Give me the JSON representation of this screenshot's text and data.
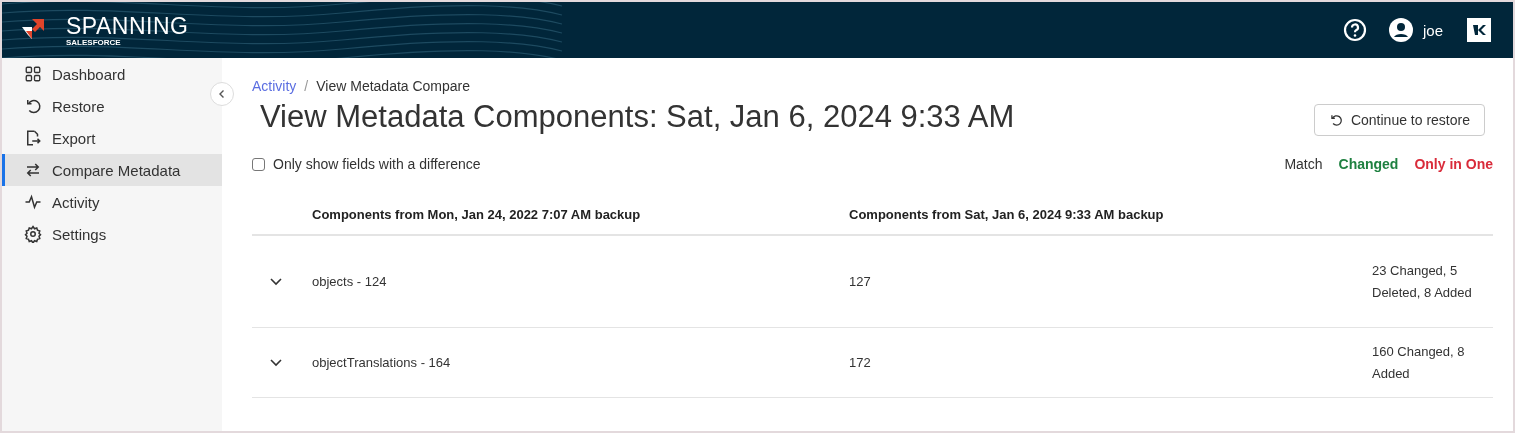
{
  "header": {
    "brand": "SPANNING",
    "sub_brand": "SALESFORCE",
    "user": "joe"
  },
  "sidebar": {
    "items": [
      {
        "label": "Dashboard",
        "kind": "grid",
        "selected": false
      },
      {
        "label": "Restore",
        "kind": "restore",
        "selected": false
      },
      {
        "label": "Export",
        "kind": "export",
        "selected": false
      },
      {
        "label": "Compare Metadata",
        "kind": "compare",
        "selected": true
      },
      {
        "label": "Activity",
        "kind": "pulse",
        "selected": false
      },
      {
        "label": "Settings",
        "kind": "gear",
        "selected": false
      }
    ]
  },
  "breadcrumb": {
    "parent": "Activity",
    "separator": "/",
    "current": "View Metadata Compare"
  },
  "title": "View Metadata Components: Sat, Jan 6, 2024 9:33 AM",
  "restore_button": "Continue to restore",
  "filter": {
    "label": "Only show fields with a difference",
    "checked": false
  },
  "legend": [
    {
      "label": "Match",
      "color": "#333333"
    },
    {
      "label": "Changed",
      "color": "#1e8040"
    },
    {
      "label": "Only in One",
      "color": "#d92b3a"
    }
  ],
  "table": {
    "columns": [
      "Components from Mon, Jan 24, 2022 7:07 AM backup",
      "Components from Sat, Jan 6, 2024 9:33 AM backup"
    ],
    "rows": [
      {
        "name": "objects - 124",
        "count": "127",
        "summary": "23 Changed, 5 Deleted, 8 Added",
        "expanded": false
      },
      {
        "name": "objectTranslations - 164",
        "count": "172",
        "summary": "160 Changed, 8 Added",
        "expanded": false
      }
    ]
  }
}
